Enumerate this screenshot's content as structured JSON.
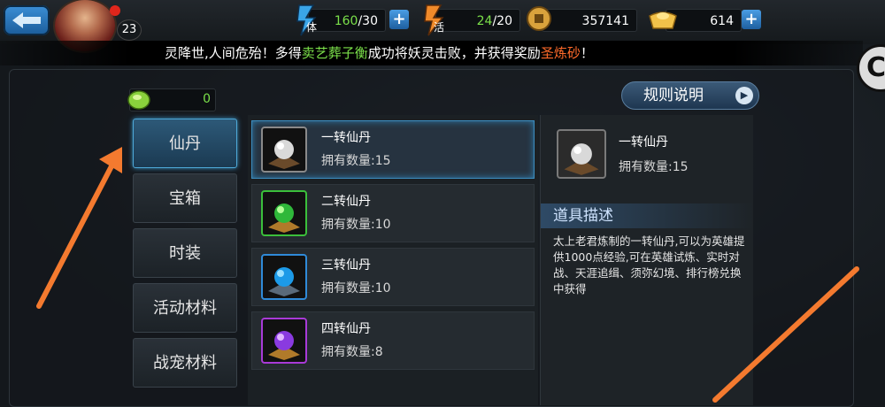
{
  "player": {
    "level": "23"
  },
  "resources": {
    "stamina": {
      "icon": "stamina-icon",
      "label": "体",
      "value": "160",
      "max": "/30"
    },
    "energy": {
      "icon": "energy-icon",
      "label": "活",
      "value": "24",
      "max": "/20"
    },
    "coins": {
      "icon": "coin-icon",
      "value": "357141"
    },
    "ingots": {
      "icon": "ingot-icon",
      "value": "614"
    }
  },
  "marquee": {
    "part1": "灵降世,人间危殆！多得",
    "player_name": "卖艺葬子衡",
    "part2": "成功将妖灵击败，并获得奖励",
    "reward": "圣炼砂",
    "part3": "！"
  },
  "currency": {
    "value": "0"
  },
  "rules_button": {
    "label": "规则说明"
  },
  "categories": [
    {
      "label": "仙丹"
    },
    {
      "label": "宝箱"
    },
    {
      "label": "时装"
    },
    {
      "label": "活动材料"
    },
    {
      "label": "战宠材料"
    }
  ],
  "items": [
    {
      "name": "一转仙丹",
      "qty": "拥有数量:15"
    },
    {
      "name": "二转仙丹",
      "qty": "拥有数量:10"
    },
    {
      "name": "三转仙丹",
      "qty": "拥有数量:10"
    },
    {
      "name": "四转仙丹",
      "qty": "拥有数量:8"
    }
  ],
  "detail": {
    "name": "一转仙丹",
    "qty": "拥有数量:15",
    "desc_header": "道具描述",
    "description": "太上老君炼制的一转仙丹,可以为英雄提供1000点经验,可在英雄试炼、实时对战、天涯追缉、须弥幻境、排行榜兑换中获得"
  },
  "colors": {
    "accent_green": "#7be04a",
    "accent_orange": "#ff6a2a",
    "arrow": "#f47a2f"
  }
}
